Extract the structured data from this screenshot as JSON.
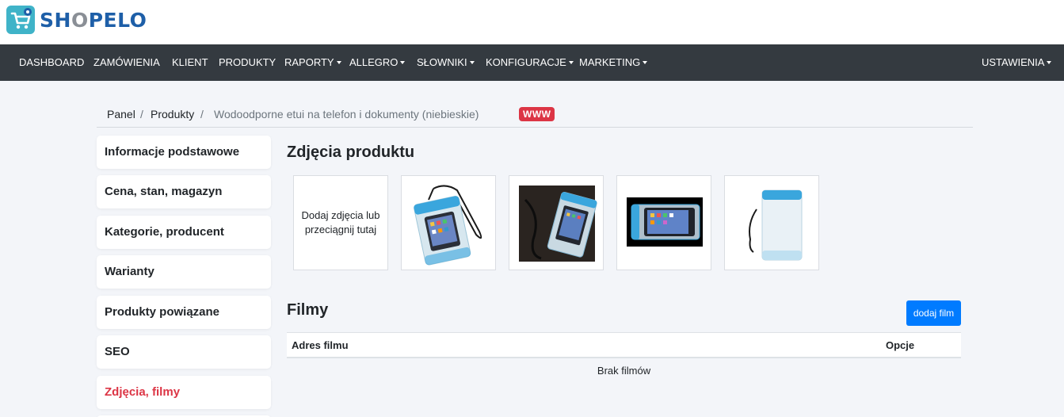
{
  "brand": {
    "name_part1": "SH",
    "name_o": "O",
    "name_part2": "PELO"
  },
  "nav": {
    "items": [
      {
        "label": "DASHBOARD"
      },
      {
        "label": "ZAMÓWIENIA"
      },
      {
        "label": "KLIENT"
      },
      {
        "label": "PRODUKTY"
      },
      {
        "label": "RAPORTY"
      },
      {
        "label": "ALLEGRO"
      },
      {
        "label": "SŁOWNIKI"
      },
      {
        "label": "KONFIGURACJE"
      },
      {
        "label": "MARKETING"
      }
    ],
    "settings": {
      "label": "USTAWIENIA"
    }
  },
  "breadcrumb": {
    "items": [
      "Panel",
      "Produkty",
      "Wodoodporne etui na telefon i dokumenty (niebieskie)"
    ],
    "separator": "/",
    "badge": "WWW"
  },
  "sidebar": {
    "items": [
      {
        "label": "Informacje podstawowe"
      },
      {
        "label": "Cena, stan, magazyn"
      },
      {
        "label": "Kategorie, producent"
      },
      {
        "label": "Warianty"
      },
      {
        "label": "Produkty powiązane"
      },
      {
        "label": "SEO"
      },
      {
        "label": "Zdjęcia, filmy"
      }
    ],
    "active_index": 6
  },
  "photos": {
    "title": "Zdjęcia produktu",
    "upload_label": "Dodaj zdjęcia lub przeciągnij tutaj"
  },
  "films": {
    "title": "Filmy",
    "add_button": "dodaj film",
    "columns": [
      "Adres filmu",
      "Opcje"
    ],
    "empty_text": "Brak filmów"
  },
  "colors": {
    "navbar": "#343a40",
    "accent_active": "#dc3545",
    "primary_button": "#007bff",
    "brand_blue": "#1e5fa8",
    "logo_teal": "#3fb3c8",
    "product_blue": "#3aa6dd"
  }
}
